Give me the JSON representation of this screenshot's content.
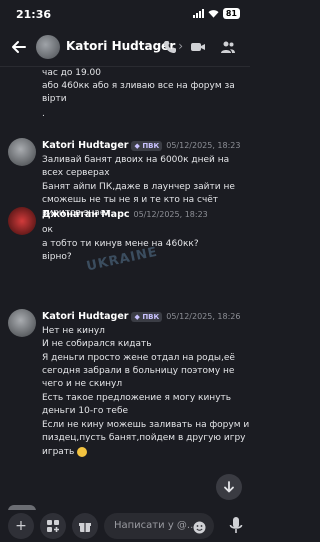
{
  "status_bar": {
    "time": "21:36",
    "battery": "81"
  },
  "header": {
    "title": "Katori Hudtager"
  },
  "messages": {
    "m0": {
      "lines": [
        "час до 19.00",
        "або 460кк або я зливаю все на форум за",
        "вірти",
        "."
      ]
    },
    "m1": {
      "author": "Katori Hudtager",
      "tag": "ПВК",
      "timestamp": "05/12/2025, 18:23",
      "lines": [
        "Заливай банят двоих на 6000к дней на",
        "всех серверах",
        "Банят айпи ПК,даже в лаунчер зайти не",
        "сможешь не ты не я и те кто на счёт",
        "виритов знает"
      ]
    },
    "m2": {
      "author": "Джонатан Марс",
      "timestamp": "05/12/2025, 18:23",
      "lines": [
        "ок",
        "а тобто ти кинув мене на 460кк?",
        "вірно?"
      ]
    },
    "m3": {
      "author": "Katori Hudtager",
      "tag": "ПВК",
      "timestamp": "05/12/2025, 18:26",
      "lines": [
        "Нет не кинул",
        "И не собирался кидать",
        "Я деньги просто жене отдал на роды,её",
        "сегодня забрали в больницу поэтому не",
        "чего и не скинул",
        "Есть такое предложение я могу кинуть",
        "деньги 10-го тебе",
        "Если не кину можешь заливать на форум и",
        "пиздец,пусть банят,пойдем в другую игру",
        "играть"
      ]
    }
  },
  "watermark": "UKRAINE",
  "composer": {
    "placeholder": "Написати у @..."
  },
  "colors": {
    "background": "#1b1c22",
    "tag_text": "#c9c2ff",
    "timestamp": "#8d8f96"
  }
}
